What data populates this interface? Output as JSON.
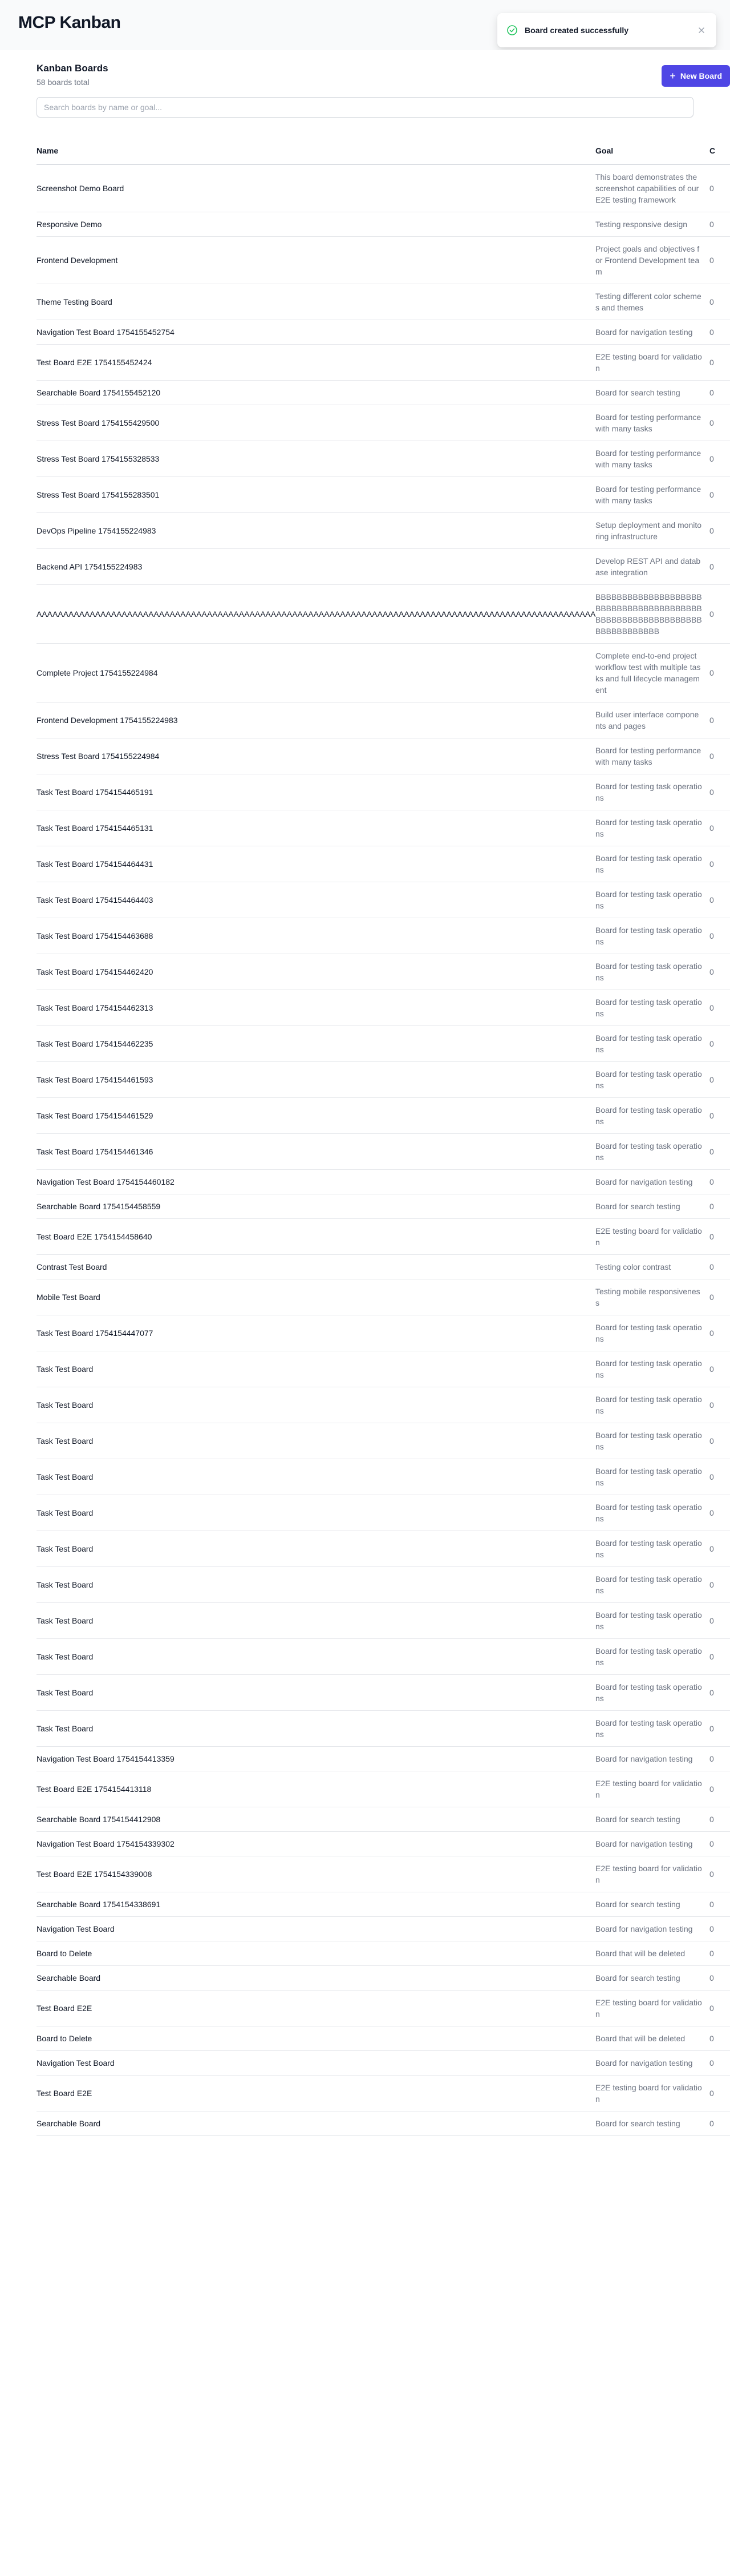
{
  "app": {
    "title": "MCP Kanban"
  },
  "toast": {
    "message": "Board created successfully",
    "close_icon": "close-icon",
    "status_icon": "check-circle-icon",
    "status_color": "#22c55e"
  },
  "boards_section": {
    "title": "Kanban Boards",
    "subtitle": "58 boards total",
    "new_board_label": "New Board",
    "search_placeholder": "Search boards by name or goal...",
    "accent_color": "#4f46e5"
  },
  "table": {
    "columns": [
      "Name",
      "Goal",
      "C"
    ],
    "rows": [
      {
        "name": "Screenshot Demo Board",
        "goal": "This board demonstrates the screenshot capabilities of our E2E testing framework",
        "extra": "0"
      },
      {
        "name": "Responsive Demo",
        "goal": "Testing responsive design",
        "extra": "0"
      },
      {
        "name": "Frontend Development",
        "goal": "Project goals and objectives for Frontend Development team",
        "extra": "0"
      },
      {
        "name": "Theme Testing Board",
        "goal": "Testing different color schemes and themes",
        "extra": "0"
      },
      {
        "name": "Navigation Test Board 1754155452754",
        "goal": "Board for navigation testing",
        "extra": "0"
      },
      {
        "name": "Test Board E2E 1754155452424",
        "goal": "E2E testing board for validation",
        "extra": "0"
      },
      {
        "name": "Searchable Board 1754155452120",
        "goal": "Board for search testing",
        "extra": "0"
      },
      {
        "name": "Stress Test Board 1754155429500",
        "goal": "Board for testing performance with many tasks",
        "extra": "0"
      },
      {
        "name": "Stress Test Board 1754155328533",
        "goal": "Board for testing performance with many tasks",
        "extra": "0"
      },
      {
        "name": "Stress Test Board 1754155283501",
        "goal": "Board for testing performance with many tasks",
        "extra": "0"
      },
      {
        "name": "DevOps Pipeline 1754155224983",
        "goal": "Setup deployment and monitoring infrastructure",
        "extra": "0"
      },
      {
        "name": "Backend API 1754155224983",
        "goal": "Develop REST API and database integration",
        "extra": "0"
      },
      {
        "name": "AAAAAAAAAAAAAAAAAAAAAAAAAAAAAAAAAAAAAAAAAAAAAAAAAAAAAAAAAAAAAAAAAAAAAAAAAAAAAAAAAAAAAAAAAAAAAAAAAAAAAAAAAAAAAAAAAAAAAAAAAAAAAAAAAA",
        "goal": "BBBBBBBBBBBBBBBBBBBBBBBBBBBBBBBBBBBBBBBBBBBBBBBBBBBBBBBBBBBBBBBBBBBBBBBB",
        "extra": "0"
      },
      {
        "name": "Complete Project 1754155224984",
        "goal": "Complete end-to-end project workflow test with multiple tasks and full lifecycle management",
        "extra": "0"
      },
      {
        "name": "Frontend Development 1754155224983",
        "goal": "Build user interface components and pages",
        "extra": "0"
      },
      {
        "name": "Stress Test Board 1754155224984",
        "goal": "Board for testing performance with many tasks",
        "extra": "0"
      },
      {
        "name": "Task Test Board 1754154465191",
        "goal": "Board for testing task operations",
        "extra": "0"
      },
      {
        "name": "Task Test Board 1754154465131",
        "goal": "Board for testing task operations",
        "extra": "0"
      },
      {
        "name": "Task Test Board 1754154464431",
        "goal": "Board for testing task operations",
        "extra": "0"
      },
      {
        "name": "Task Test Board 1754154464403",
        "goal": "Board for testing task operations",
        "extra": "0"
      },
      {
        "name": "Task Test Board 1754154463688",
        "goal": "Board for testing task operations",
        "extra": "0"
      },
      {
        "name": "Task Test Board 1754154462420",
        "goal": "Board for testing task operations",
        "extra": "0"
      },
      {
        "name": "Task Test Board 1754154462313",
        "goal": "Board for testing task operations",
        "extra": "0"
      },
      {
        "name": "Task Test Board 1754154462235",
        "goal": "Board for testing task operations",
        "extra": "0"
      },
      {
        "name": "Task Test Board 1754154461593",
        "goal": "Board for testing task operations",
        "extra": "0"
      },
      {
        "name": "Task Test Board 1754154461529",
        "goal": "Board for testing task operations",
        "extra": "0"
      },
      {
        "name": "Task Test Board 1754154461346",
        "goal": "Board for testing task operations",
        "extra": "0"
      },
      {
        "name": "Navigation Test Board 1754154460182",
        "goal": "Board for navigation testing",
        "extra": "0"
      },
      {
        "name": "Searchable Board 1754154458559",
        "goal": "Board for search testing",
        "extra": "0"
      },
      {
        "name": "Test Board E2E 1754154458640",
        "goal": "E2E testing board for validation",
        "extra": "0"
      },
      {
        "name": "Contrast Test Board",
        "goal": "Testing color contrast",
        "extra": "0"
      },
      {
        "name": "Mobile Test Board",
        "goal": "Testing mobile responsiveness",
        "extra": "0"
      },
      {
        "name": "Task Test Board 1754154447077",
        "goal": "Board for testing task operations",
        "extra": "0"
      },
      {
        "name": "Task Test Board",
        "goal": "Board for testing task operations",
        "extra": "0"
      },
      {
        "name": "Task Test Board",
        "goal": "Board for testing task operations",
        "extra": "0"
      },
      {
        "name": "Task Test Board",
        "goal": "Board for testing task operations",
        "extra": "0"
      },
      {
        "name": "Task Test Board",
        "goal": "Board for testing task operations",
        "extra": "0"
      },
      {
        "name": "Task Test Board",
        "goal": "Board for testing task operations",
        "extra": "0"
      },
      {
        "name": "Task Test Board",
        "goal": "Board for testing task operations",
        "extra": "0"
      },
      {
        "name": "Task Test Board",
        "goal": "Board for testing task operations",
        "extra": "0"
      },
      {
        "name": "Task Test Board",
        "goal": "Board for testing task operations",
        "extra": "0"
      },
      {
        "name": "Task Test Board",
        "goal": "Board for testing task operations",
        "extra": "0"
      },
      {
        "name": "Task Test Board",
        "goal": "Board for testing task operations",
        "extra": "0"
      },
      {
        "name": "Task Test Board",
        "goal": "Board for testing task operations",
        "extra": "0"
      },
      {
        "name": "Navigation Test Board 1754154413359",
        "goal": "Board for navigation testing",
        "extra": "0"
      },
      {
        "name": "Test Board E2E 1754154413118",
        "goal": "E2E testing board for validation",
        "extra": "0"
      },
      {
        "name": "Searchable Board 1754154412908",
        "goal": "Board for search testing",
        "extra": "0"
      },
      {
        "name": "Navigation Test Board 1754154339302",
        "goal": "Board for navigation testing",
        "extra": "0"
      },
      {
        "name": "Test Board E2E 1754154339008",
        "goal": "E2E testing board for validation",
        "extra": "0"
      },
      {
        "name": "Searchable Board 1754154338691",
        "goal": "Board for search testing",
        "extra": "0"
      },
      {
        "name": "Navigation Test Board",
        "goal": "Board for navigation testing",
        "extra": "0"
      },
      {
        "name": "Board to Delete",
        "goal": "Board that will be deleted",
        "extra": "0"
      },
      {
        "name": "Searchable Board",
        "goal": "Board for search testing",
        "extra": "0"
      },
      {
        "name": "Test Board E2E",
        "goal": "E2E testing board for validation",
        "extra": "0"
      },
      {
        "name": "Board to Delete",
        "goal": "Board that will be deleted",
        "extra": "0"
      },
      {
        "name": "Navigation Test Board",
        "goal": "Board for navigation testing",
        "extra": "0"
      },
      {
        "name": "Test Board E2E",
        "goal": "E2E testing board for validation",
        "extra": "0"
      },
      {
        "name": "Searchable Board",
        "goal": "Board for search testing",
        "extra": "0"
      }
    ]
  }
}
